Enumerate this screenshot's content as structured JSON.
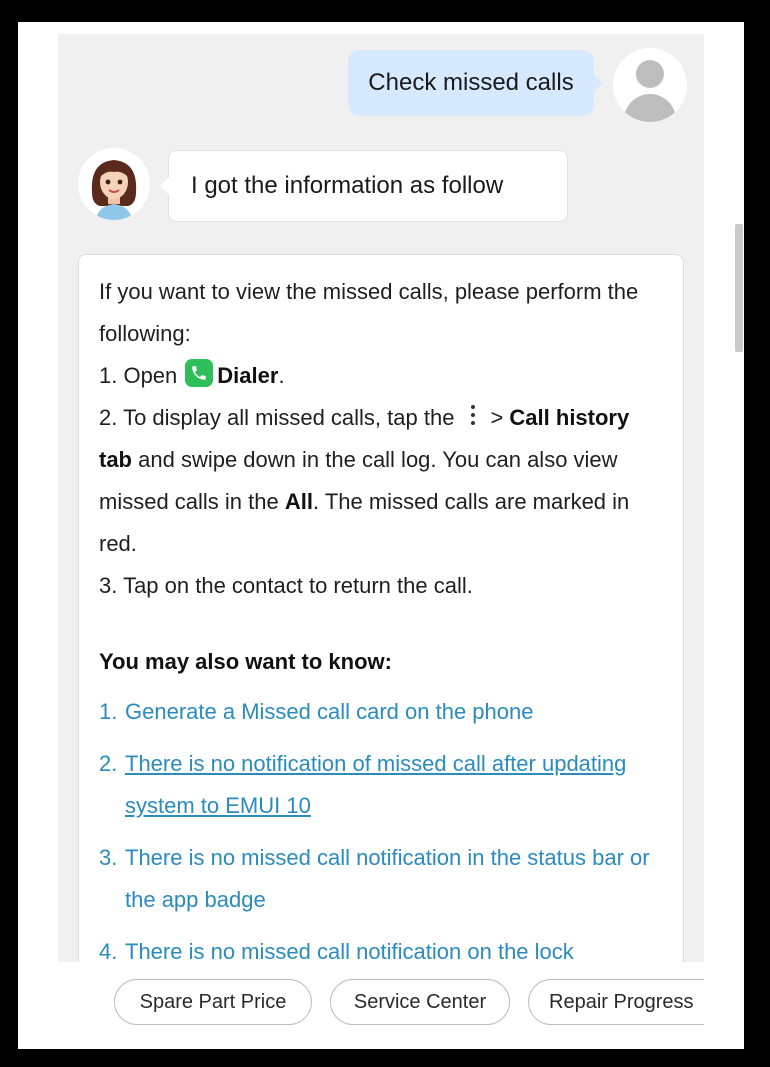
{
  "conversation": {
    "user_message": "Check missed calls",
    "bot_intro": "I got the information as follow",
    "answer": {
      "line1": "If you want to view the missed calls, please perform the following:",
      "step1_prefix": "1. Open",
      "step1_app": "Dialer",
      "step1_suffix": ".",
      "step2_prefix": "2. To display all missed calls, tap the",
      "step2_gt": ">",
      "step2_bold": "Call history tab",
      "step2_mid": "and swipe down in the call log. You can also view missed calls in the",
      "step2_all": "All",
      "step2_end": ". The missed calls are marked in red.",
      "step3": "3. Tap on the contact to return the call."
    },
    "related": {
      "title": "You may also want to know:",
      "items": [
        {
          "num": "1.",
          "text": "Generate a Missed call card on the phone"
        },
        {
          "num": "2.",
          "text": "There is no notification of missed call after updating system to EMUI 10"
        },
        {
          "num": "3.",
          "text": "There is no missed call notification in the status bar or the app badge"
        },
        {
          "num": "4.",
          "text": "There is no missed call notification on the lock"
        }
      ]
    }
  },
  "suggestions": [
    "Spare Part Price",
    "Service Center",
    "Repair Progress"
  ],
  "icons": {
    "user_avatar": "user-avatar-icon",
    "bot_avatar": "assistant-avatar-icon",
    "dialer": "phone-icon",
    "more": "more-vertical-icon"
  },
  "colors": {
    "user_bubble": "#d6e9ff",
    "link": "#2a8bbd",
    "dialer_green": "#2fbf5a",
    "chat_background": "#f0f0f0"
  }
}
